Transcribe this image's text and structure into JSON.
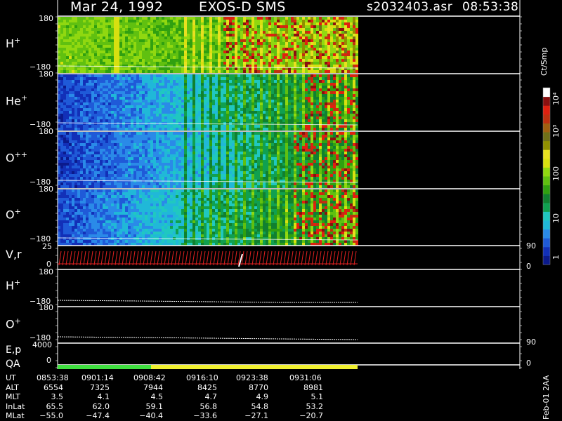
{
  "header": {
    "date": "Mar 24, 1992",
    "instrument": "EXOS-D SMS",
    "file": "s2032403.asr",
    "time": "08:53:38"
  },
  "colorbar": {
    "unit_label": "Ct/Smp",
    "ticks": [
      {
        "label": "1",
        "value": 1
      },
      {
        "label": "10",
        "value": 10
      },
      {
        "label": "100",
        "value": 100
      },
      {
        "label": "10³",
        "value": 1000
      },
      {
        "label": "10⁴",
        "value": 10000
      }
    ],
    "colors": [
      "#0b1a8c",
      "#1230b8",
      "#1f5ad8",
      "#2a8ae8",
      "#20b8d8",
      "#20c8c0",
      "#10a050",
      "#108030",
      "#30a010",
      "#60c010",
      "#90d810",
      "#d8e010",
      "#e8e020",
      "#909000",
      "#707018",
      "#a06010",
      "#c03010",
      "#e02010",
      "#8a1010",
      "#ffffff"
    ]
  },
  "panels": [
    {
      "species": "H",
      "charge": "+",
      "ymax": "180",
      "ymin": "−180"
    },
    {
      "species": "He",
      "charge": "+",
      "ymax": "180",
      "ymin": "−180"
    },
    {
      "species": "O",
      "charge": "++",
      "ymax": "180",
      "ymin": "−180"
    },
    {
      "species": "O",
      "charge": "+",
      "ymax": "180",
      "ymin": "−180"
    }
  ],
  "vr_panel": {
    "label": "V,r",
    "left_ticks": [
      "25",
      "0"
    ],
    "right_ticks": [
      "90",
      "0"
    ]
  },
  "h_line_panel": {
    "species": "H",
    "charge": "+",
    "ymax": "180",
    "ymin": "−180"
  },
  "o_line_panel": {
    "species": "O",
    "charge": "+",
    "ymax": "180",
    "ymin": "−180"
  },
  "ep_panel": {
    "label": "E,p",
    "left_tick": "4000",
    "right_ticks": [
      "90",
      "0"
    ]
  },
  "qa_panel": {
    "label": "QA",
    "left_tick": "0",
    "status_colors": [
      "#40e040",
      "#f0f030"
    ]
  },
  "ephemeris": {
    "rows": [
      {
        "name": "UT",
        "values": [
          "0853:38",
          "0901:14",
          "0908:42",
          "0916:10",
          "0923:38",
          "0931:06"
        ]
      },
      {
        "name": "ALT",
        "values": [
          "6554",
          "7325",
          "7944",
          "8425",
          "8770",
          "8981"
        ]
      },
      {
        "name": "MLT",
        "values": [
          "3.5",
          "4.1",
          "4.5",
          "4.7",
          "4.9",
          "5.1"
        ]
      },
      {
        "name": "InLat",
        "values": [
          "65.5",
          "62.0",
          "59.1",
          "56.8",
          "54.8",
          "53.2"
        ]
      },
      {
        "name": "MLat",
        "values": [
          "−55.0",
          "−47.4",
          "−40.4",
          "−33.6",
          "−27.1",
          "−20.7"
        ]
      }
    ]
  },
  "footer_stamp": "Feb-01 2AA",
  "chart_data": {
    "type": "heatmap",
    "title": "Mar 24, 1992   EXOS-D SMS",
    "x_ticks_ut": [
      "0853:38",
      "0901:14",
      "0908:42",
      "0916:10",
      "0923:38",
      "0931:06"
    ],
    "ylim": [
      -180,
      180
    ],
    "colorbar_range": [
      1,
      10000
    ],
    "colorbar_unit": "Ct/Smp",
    "series": [
      {
        "name": "H+",
        "dominant_level": "10-100"
      },
      {
        "name": "He+",
        "dominant_level": "1-10"
      },
      {
        "name": "O++",
        "dominant_level": "1-10"
      },
      {
        "name": "O+",
        "dominant_level": "1-10"
      }
    ]
  }
}
